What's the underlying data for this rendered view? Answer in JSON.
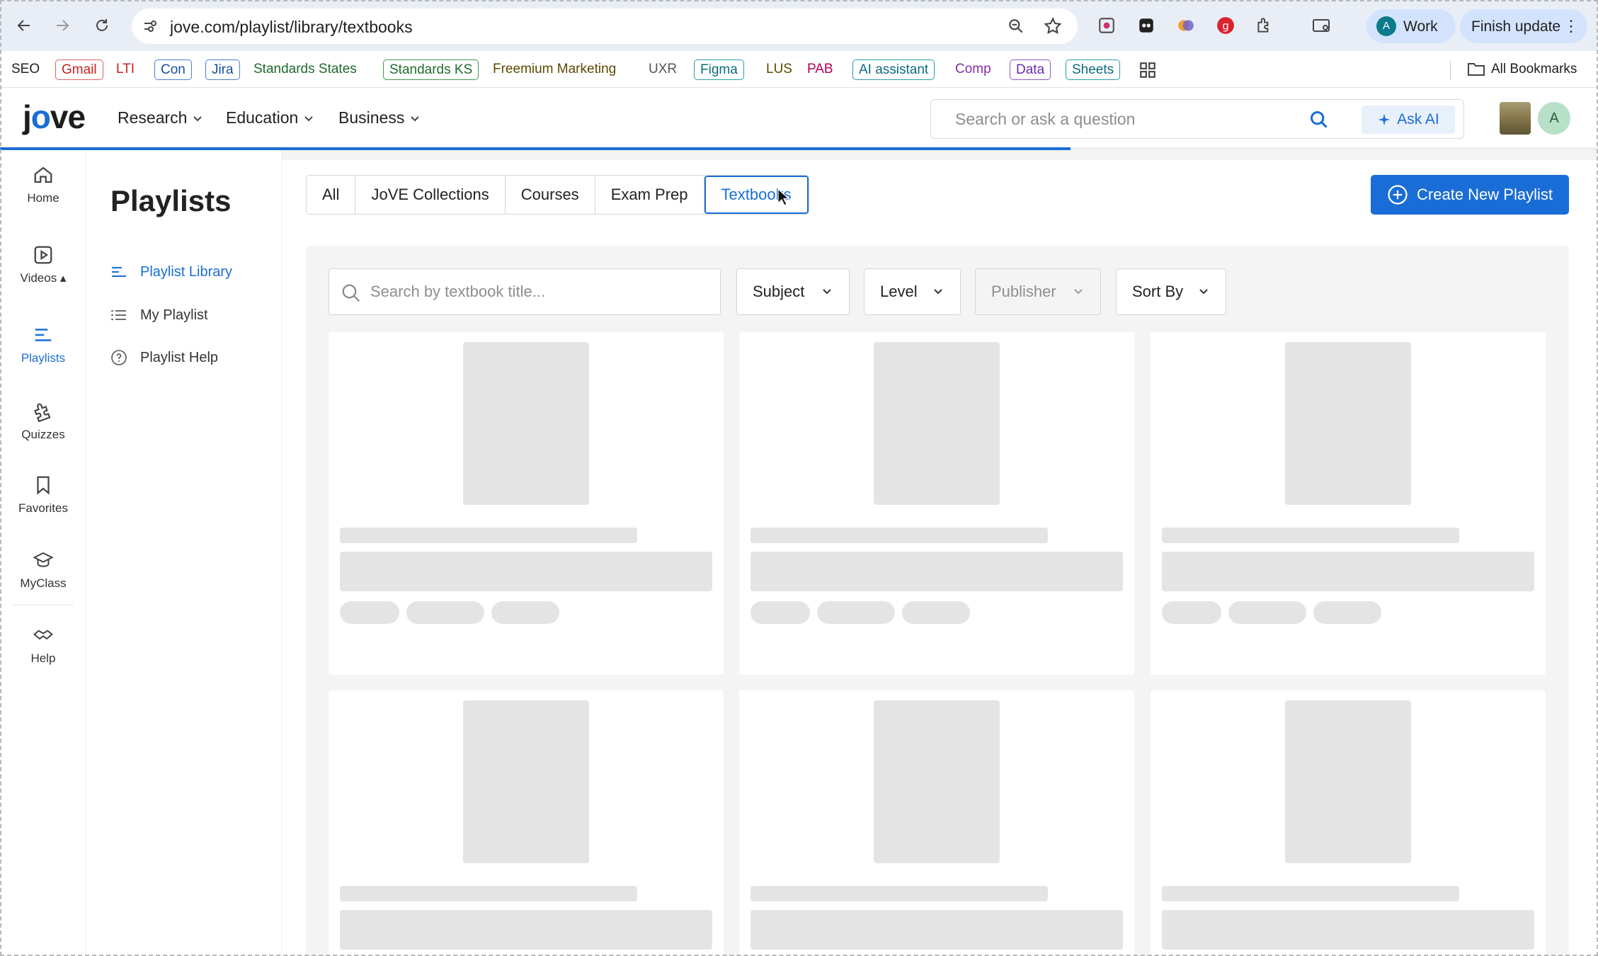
{
  "browser": {
    "url": "jove.com/playlist/library/textbooks",
    "profile_initial": "A",
    "profile_label": "Work",
    "update_label": "Finish update"
  },
  "bookmarks": [
    {
      "label": "SEO",
      "color": "#1f1f1f",
      "border": "none"
    },
    {
      "label": "Gmail",
      "color": "#c5221f",
      "border": "#e06060"
    },
    {
      "label": "LTI",
      "color": "#c5221f",
      "border": "none"
    },
    {
      "label": "Con",
      "color": "#1a4fa0",
      "border": "#4a7fd0"
    },
    {
      "label": "Jira",
      "color": "#1a4fa0",
      "border": "#4a7fd0"
    },
    {
      "label": "Standards States",
      "color": "#1e6b2e",
      "border": "none"
    },
    {
      "label": "Standards KS",
      "color": "#1e6b2e",
      "border": "#3c9a4e"
    },
    {
      "label": "Freemium Marketing",
      "color": "#5b4a00",
      "border": "none"
    },
    {
      "label": "UXR",
      "color": "#555555",
      "border": "none"
    },
    {
      "label": "Figma",
      "color": "#0b6b7b",
      "border": "#2b9aab"
    },
    {
      "label": "LUS",
      "color": "#5b4a00",
      "border": "none"
    },
    {
      "label": "PAB",
      "color": "#b0005a",
      "border": "none"
    },
    {
      "label": "AI assistant",
      "color": "#0b6b7b",
      "border": "#2b9aab"
    },
    {
      "label": "Comp",
      "color": "#8a2bb0",
      "border": "none"
    },
    {
      "label": "Data",
      "color": "#6a2bb0",
      "border": "#8a5bd0"
    },
    {
      "label": "Sheets",
      "color": "#0b6b7b",
      "border": "#2b9aab"
    }
  ],
  "all_bookmarks_label": "All Bookmarks",
  "header": {
    "nav": [
      "Research",
      "Education",
      "Business"
    ],
    "search_placeholder": "Search or ask a question",
    "ask_ai_label": "Ask AI",
    "user_initial": "A",
    "load_progress": 0.67
  },
  "rail": [
    {
      "label": "Home",
      "icon": "home-icon",
      "active": false
    },
    {
      "label": "Videos ▴",
      "icon": "video-icon",
      "active": false
    },
    {
      "label": "Playlists",
      "icon": "playlist-icon",
      "active": true
    },
    {
      "label": "Quizzes",
      "icon": "puzzle-icon",
      "active": false
    },
    {
      "label": "Favorites",
      "icon": "bookmark-icon",
      "active": false
    },
    {
      "label": "MyClass",
      "icon": "graduation-cap-icon",
      "active": false
    },
    {
      "label": "Help",
      "icon": "handshake-icon",
      "active": false
    }
  ],
  "sidebar": {
    "title": "Playlists",
    "items": [
      {
        "label": "Playlist Library",
        "icon": "playlist-library-icon",
        "active": true
      },
      {
        "label": "My Playlist",
        "icon": "list-icon",
        "active": false
      },
      {
        "label": "Playlist Help",
        "icon": "help-circle-icon",
        "active": false
      }
    ]
  },
  "tabs": [
    {
      "label": "All",
      "active": false
    },
    {
      "label": "JoVE Collections",
      "active": false
    },
    {
      "label": "Courses",
      "active": false
    },
    {
      "label": "Exam Prep",
      "active": false
    },
    {
      "label": "Textbooks",
      "active": true
    }
  ],
  "create_button_label": "Create New Playlist",
  "filters": {
    "search_placeholder": "Search by textbook title...",
    "dropdowns": [
      {
        "label": "Subject",
        "disabled": false
      },
      {
        "label": "Level",
        "disabled": false
      },
      {
        "label": "Publisher",
        "disabled": true
      },
      {
        "label": "Sort By",
        "disabled": false
      }
    ]
  },
  "colors": {
    "accent": "#1a6dd6",
    "skeleton": "#e4e4e4",
    "panel": "#f4f4f4"
  }
}
